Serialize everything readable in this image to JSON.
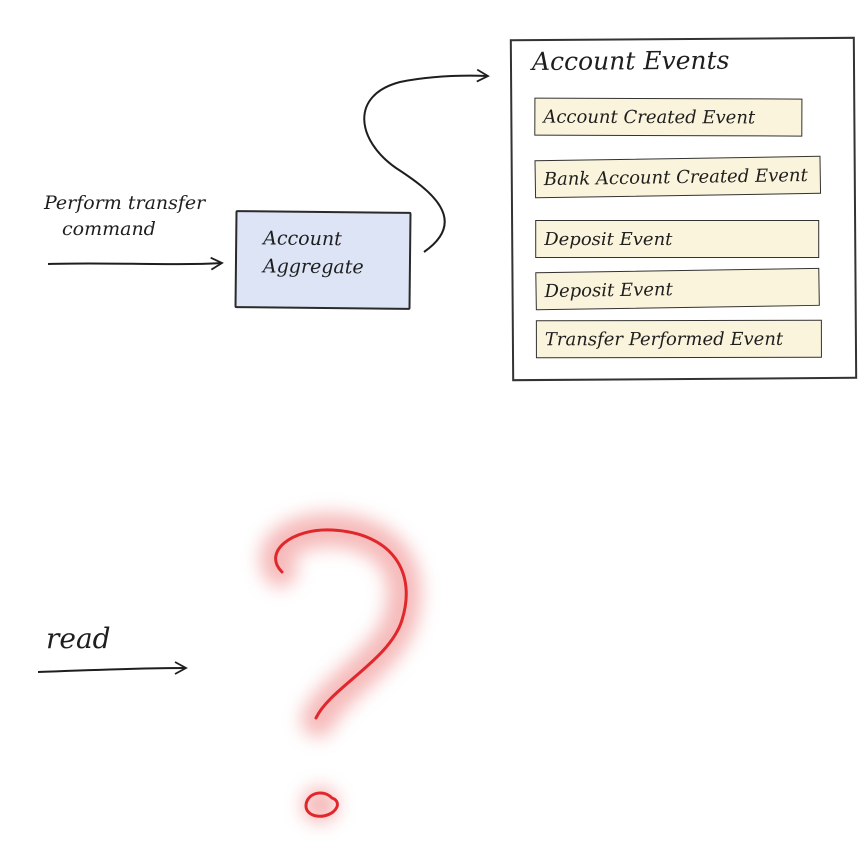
{
  "command": {
    "line1": "Perform transfer",
    "line2": "command"
  },
  "aggregate": {
    "line1": "Account",
    "line2": "Aggregate"
  },
  "event_store": {
    "title": "Account Events",
    "events": [
      "Account Created Event",
      "Bank Account Created Event",
      "Deposit Event",
      "Deposit Event",
      "Transfer Performed Event"
    ]
  },
  "read": {
    "label": "read"
  },
  "colors": {
    "aggregate_fill": "#dde4f6",
    "event_fill": "#fbf4dc",
    "question_mark": "#e0272c",
    "question_glow": "#f3a3a3"
  },
  "icons": {
    "unknown": "question-mark-icon"
  }
}
